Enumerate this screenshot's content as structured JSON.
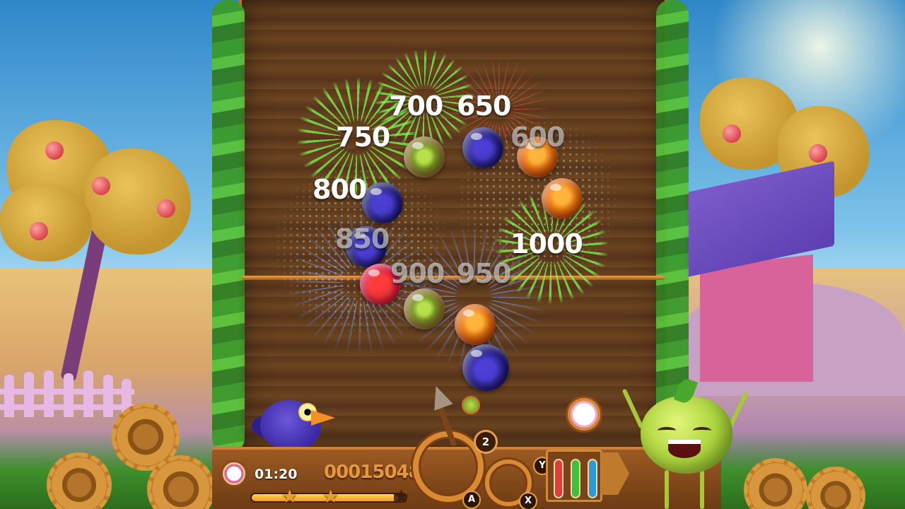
{
  "hud": {
    "timer": "01:20",
    "score": "00015048",
    "progress_fraction": 0.92,
    "stars_earned": 2,
    "stars_total": 3,
    "shots_count": "2",
    "buttons": {
      "a": "A",
      "x": "X",
      "y": "Y"
    }
  },
  "score_popups": [
    "700",
    "650",
    "750",
    "600",
    "800",
    "850",
    "1000",
    "900",
    "950"
  ],
  "colors": {
    "board_wood": "#5a3719",
    "rope": "#f0a44a",
    "score_orange": "#e6973c",
    "vine_green": "#3a9a2a",
    "tube_red": "#e23b3b",
    "tube_green": "#3bc23b",
    "tube_blue": "#2d9ad8"
  },
  "fruit_chain": [
    "kiwi",
    "blueberry",
    "orange",
    "orange",
    "blueberry",
    "blueberry",
    "strawberry",
    "kiwi",
    "orange",
    "blueberry"
  ],
  "icons": [
    "timer-icon",
    "arrow-launcher-icon",
    "gauge-icon",
    "star-icon"
  ]
}
